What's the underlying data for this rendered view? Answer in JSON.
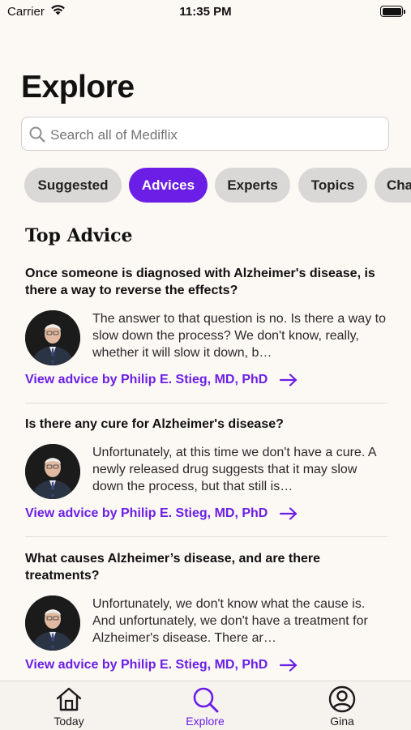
{
  "status_bar": {
    "carrier": "Carrier",
    "time": "11:35 PM"
  },
  "page_title": "Explore",
  "search": {
    "placeholder": "Search all of Mediflix"
  },
  "tabs": [
    {
      "label": "Suggested",
      "active": false
    },
    {
      "label": "Advices",
      "active": true
    },
    {
      "label": "Experts",
      "active": false
    },
    {
      "label": "Topics",
      "active": false
    },
    {
      "label": "Cha",
      "active": false
    }
  ],
  "section_title": "Top Advice",
  "advices": [
    {
      "question": "Once someone is diagnosed with Alzheimer's disease, is there a way to reverse the effects?",
      "answer": "The answer to that question is no. Is there a way to slow down the process? We don't know, really, whether it will slow it down, b…",
      "link": "View advice by Philip E. Stieg, MD, PhD"
    },
    {
      "question": "Is there any cure for Alzheimer's disease?",
      "answer": "Unfortunately, at this time we don't have a cure. A newly released drug suggests that it may slow down the process, but that still is…",
      "link": "View advice by Philip E. Stieg, MD, PhD"
    },
    {
      "question": "What causes Alzheimer’s disease, and are there treatments?",
      "answer": "Unfortunately, we don't know what the cause is. And unfortunately, we don't have a treatment for Alzheimer's disease. There ar…",
      "link": "View advice by Philip E. Stieg, MD, PhD"
    }
  ],
  "tab_bar": [
    {
      "label": "Today",
      "icon": "home-icon",
      "active": false
    },
    {
      "label": "Explore",
      "icon": "search-icon",
      "active": true
    },
    {
      "label": "Gina",
      "icon": "profile-icon",
      "active": false
    }
  ],
  "colors": {
    "accent": "#6B1FE6",
    "background": "#FCF8F4",
    "pill": "#D9D8D6"
  }
}
